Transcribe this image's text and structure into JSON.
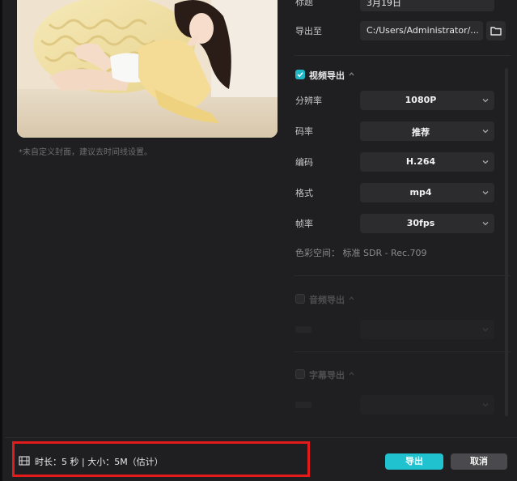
{
  "cover": {
    "hint": "*未自定义封面，建议去时间线设置。"
  },
  "form": {
    "title_label": "标题",
    "title_value": "3月19日",
    "export_to_label": "导出至",
    "export_path": "C:/Users/Administrator/..."
  },
  "video_section": {
    "label": "视频导出",
    "checked": true,
    "resolution_label": "分辨率",
    "resolution_value": "1080P",
    "bitrate_label": "码率",
    "bitrate_value": "推荐",
    "codec_label": "编码",
    "codec_value": "H.264",
    "format_label": "格式",
    "format_value": "mp4",
    "framerate_label": "帧率",
    "framerate_value": "30fps",
    "color_space": "色彩空间：  标准 SDR - Rec.709"
  },
  "audio_section": {
    "label": "音频导出",
    "checked": false
  },
  "subtitle_section": {
    "label": "字幕导出",
    "checked": false
  },
  "footer": {
    "info": "时长：5 秒 | 大小：5M（估计）",
    "export_button": "导出",
    "cancel_button": "取消"
  },
  "colors": {
    "accent": "#20c2d0",
    "highlight_box": "#e31b1b",
    "background": "#1f1f21"
  },
  "icons": {
    "folder": "folder-icon",
    "chevron": "chevron-down-icon",
    "film": "film-icon",
    "check": "check-icon"
  }
}
